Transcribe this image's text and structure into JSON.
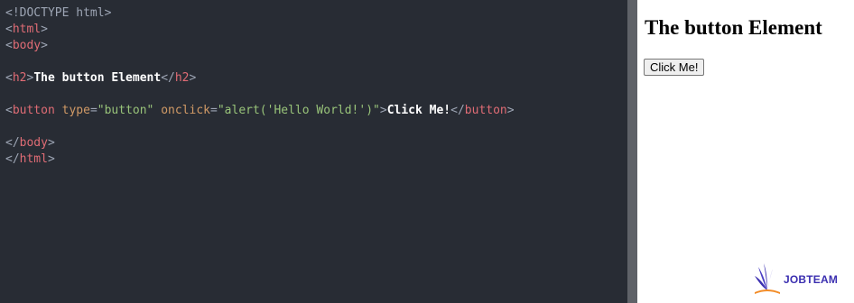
{
  "editor": {
    "lines": [
      [
        {
          "t": "<!DOCTYPE html>",
          "c": "doctype"
        }
      ],
      [
        {
          "t": "<",
          "c": "bracket"
        },
        {
          "t": "html",
          "c": "tag"
        },
        {
          "t": ">",
          "c": "bracket"
        }
      ],
      [
        {
          "t": "<",
          "c": "bracket"
        },
        {
          "t": "body",
          "c": "tag"
        },
        {
          "t": ">",
          "c": "bracket"
        }
      ],
      [],
      [
        {
          "t": "<",
          "c": "bracket"
        },
        {
          "t": "h2",
          "c": "tag"
        },
        {
          "t": ">",
          "c": "bracket"
        },
        {
          "t": "The button Element",
          "c": "text"
        },
        {
          "t": "</",
          "c": "bracket"
        },
        {
          "t": "h2",
          "c": "tag"
        },
        {
          "t": ">",
          "c": "bracket"
        }
      ],
      [],
      [
        {
          "t": "<",
          "c": "bracket"
        },
        {
          "t": "button",
          "c": "tag"
        },
        {
          "t": " type",
          "c": "attr"
        },
        {
          "t": "=",
          "c": "bracket"
        },
        {
          "t": "\"button\"",
          "c": "val"
        },
        {
          "t": " onclick",
          "c": "attr"
        },
        {
          "t": "=",
          "c": "bracket"
        },
        {
          "t": "\"alert('Hello World!')\"",
          "c": "val"
        },
        {
          "t": ">",
          "c": "bracket"
        },
        {
          "t": "Click Me!",
          "c": "text"
        },
        {
          "t": "</",
          "c": "bracket"
        },
        {
          "t": "button",
          "c": "tag"
        },
        {
          "t": ">",
          "c": "bracket"
        }
      ],
      [],
      [
        {
          "t": "</",
          "c": "bracket"
        },
        {
          "t": "body",
          "c": "tag"
        },
        {
          "t": ">",
          "c": "bracket"
        }
      ],
      [
        {
          "t": "</",
          "c": "bracket"
        },
        {
          "t": "html",
          "c": "tag"
        },
        {
          "t": ">",
          "c": "bracket"
        }
      ]
    ]
  },
  "result": {
    "heading": "The button Element",
    "button_label": "Click Me!"
  },
  "logo": {
    "text": "JOBTEAM",
    "icon": "book-leaves-icon",
    "colors": {
      "primary": "#3b2fb0",
      "accent": "#f28c28"
    }
  }
}
